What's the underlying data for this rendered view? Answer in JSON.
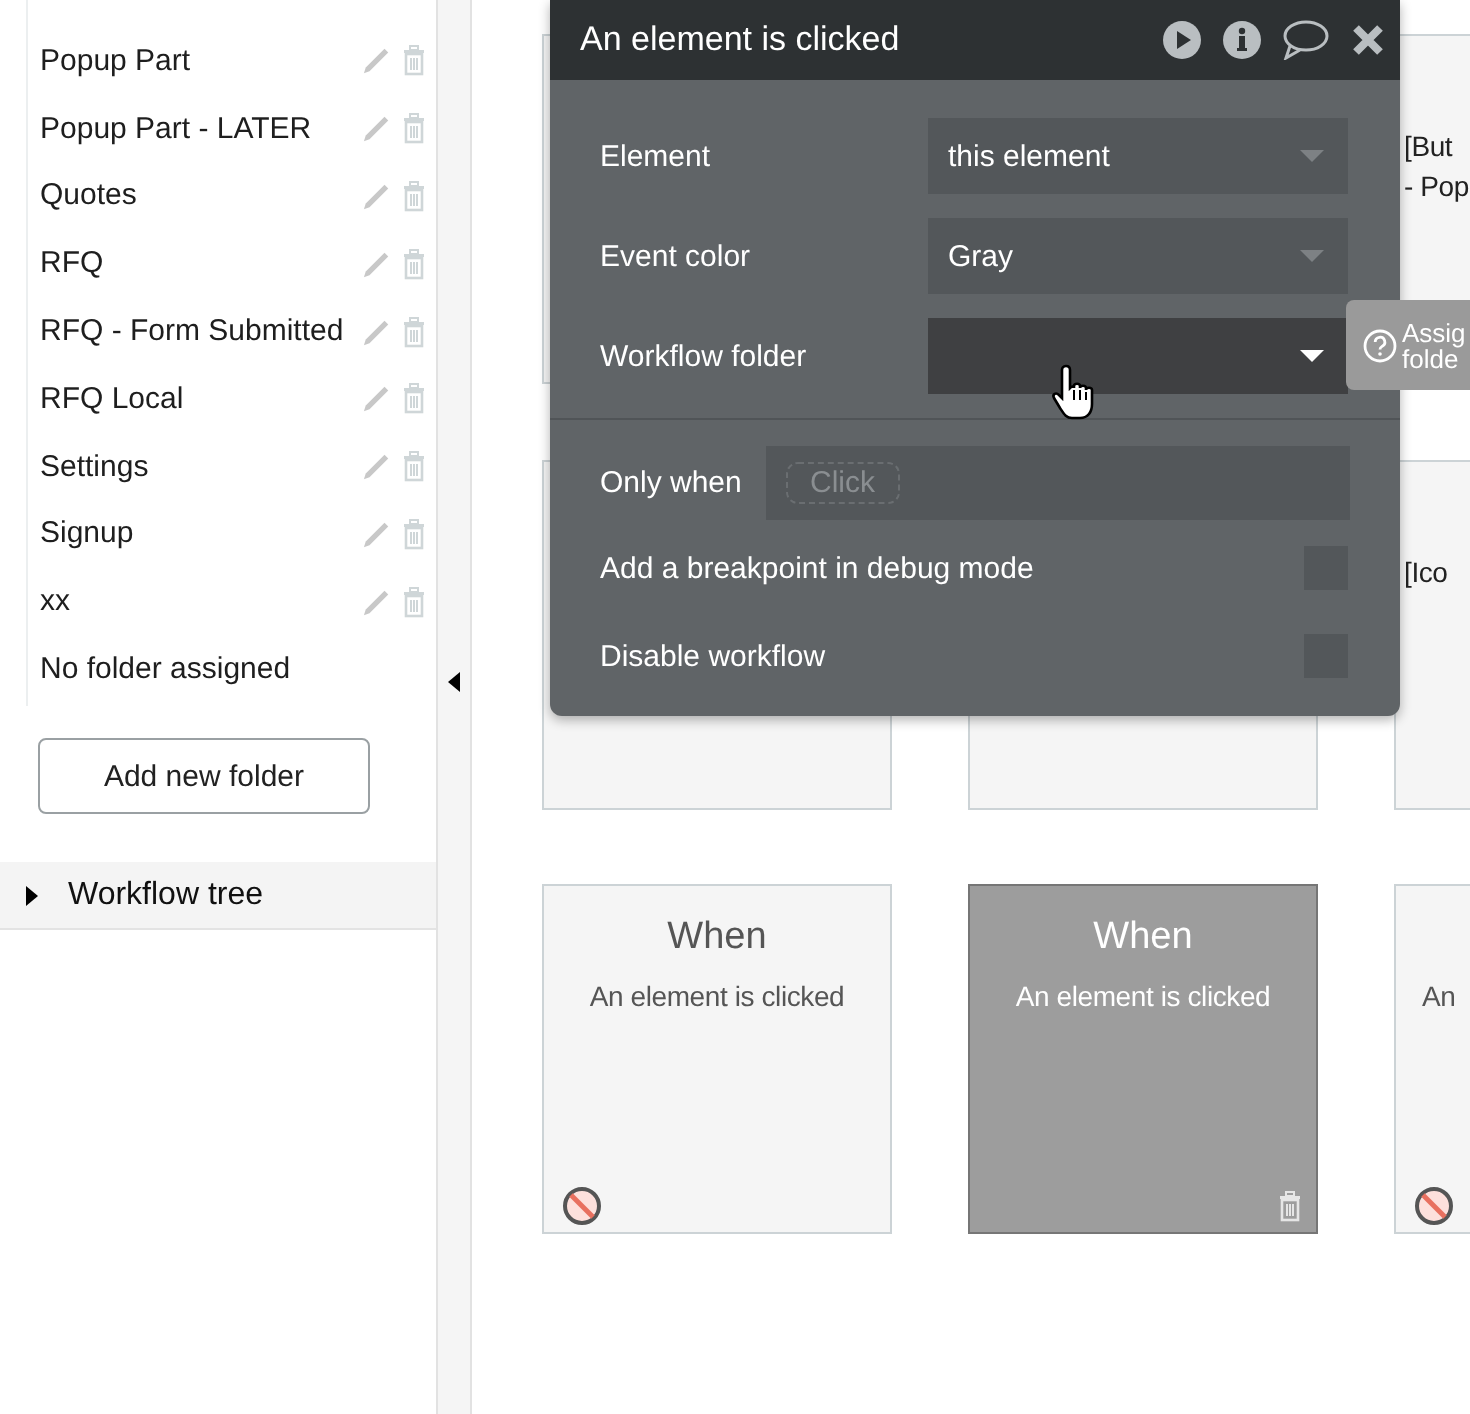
{
  "sidebar": {
    "folders": [
      {
        "name": "Popup Part",
        "kind": "folder"
      },
      {
        "name": "Popup Part - LATER",
        "kind": "folder"
      },
      {
        "name": "Quotes",
        "kind": "folder"
      },
      {
        "name": "RFQ",
        "kind": "folder"
      },
      {
        "name": "RFQ - Form Submitted",
        "kind": "folder"
      },
      {
        "name": "RFQ Local",
        "kind": "folder"
      },
      {
        "name": "Settings",
        "kind": "folder"
      },
      {
        "name": "Signup",
        "kind": "folder"
      },
      {
        "name": "xx",
        "kind": "folder"
      },
      {
        "name": "No folder assigned",
        "kind": "unassigned"
      }
    ],
    "add_button": "Add new folder",
    "workflow_tree": {
      "label": "Workflow tree",
      "expanded": false
    }
  },
  "canvas": {
    "cards": [
      {
        "selected": false,
        "disabled": false
      },
      {
        "lines": [
          "[But",
          "- Pop"
        ],
        "selected": false,
        "disabled": false
      },
      {
        "selected": false,
        "disabled": false
      },
      {
        "selected": false,
        "disabled": false
      },
      {
        "lines": [
          "[Ico"
        ],
        "selected": false,
        "disabled": false
      },
      {
        "title": "When",
        "lines": [
          "An element is clicked"
        ],
        "selected": false,
        "disabled": true
      },
      {
        "title": "When",
        "lines": [
          "An element is clicked"
        ],
        "selected": true,
        "disabled": false
      },
      {
        "lines": [
          "An"
        ],
        "selected": false,
        "disabled": true
      }
    ]
  },
  "popup": {
    "title": "An element is clicked",
    "fields": [
      {
        "kind": "dropdown",
        "label": "Element",
        "value": "this element"
      },
      {
        "kind": "dropdown",
        "label": "Event color",
        "value": "Gray"
      },
      {
        "kind": "dropdown",
        "label": "Workflow folder",
        "focused": true
      },
      {
        "kind": "condition",
        "label": "Only when",
        "placeholder": "Click"
      },
      {
        "kind": "checkbox",
        "label": "Add a breakpoint in debug mode",
        "checked": false
      },
      {
        "kind": "checkbox",
        "label": "Disable workflow",
        "checked": false
      }
    ]
  },
  "tooltip": {
    "lines": [
      "Assig",
      "folde"
    ]
  }
}
